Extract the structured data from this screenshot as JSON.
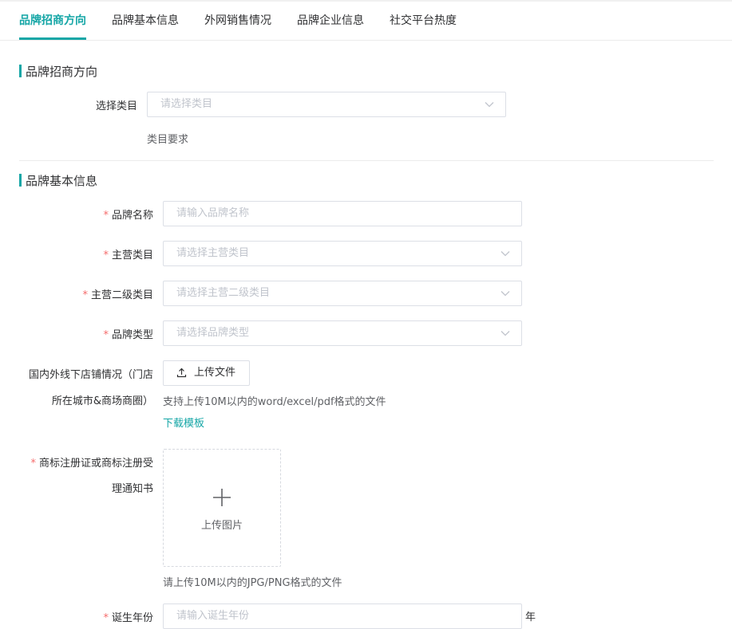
{
  "tabs": [
    {
      "label": "品牌招商方向",
      "active": true
    },
    {
      "label": "品牌基本信息",
      "active": false
    },
    {
      "label": "外网销售情况",
      "active": false
    },
    {
      "label": "品牌企业信息",
      "active": false
    },
    {
      "label": "社交平台热度",
      "active": false
    }
  ],
  "section1": {
    "title": "品牌招商方向",
    "category_label": "选择类目",
    "category_placeholder": "请选择类目",
    "category_requirement": "类目要求"
  },
  "section2": {
    "title": "品牌基本信息",
    "brand_name": {
      "label": "品牌名称",
      "placeholder": "请输入品牌名称",
      "required": true
    },
    "main_category": {
      "label": "主营类目",
      "placeholder": "请选择主营类目",
      "required": true
    },
    "sub_category": {
      "label": "主营二级类目",
      "placeholder": "请选择主营二级类目",
      "required": true
    },
    "brand_type": {
      "label": "品牌类型",
      "placeholder": "请选择品牌类型",
      "required": true
    },
    "offline_stores": {
      "label_line1": "国内外线下店铺情况（门店",
      "label_line2": "所在城市&商场商圈）",
      "upload_label": "上传文件",
      "hint": "支持上传10M以内的word/excel/pdf格式的文件",
      "template_link": "下载模板"
    },
    "trademark": {
      "label_line1": "商标注册证或商标注册受",
      "label_line2": "理通知书",
      "required": true,
      "upload_label": "上传图片",
      "hint": "请上传10M以内的JPG/PNG格式的文件"
    },
    "birth_year": {
      "label": "诞生年份",
      "placeholder": "请输入诞生年份",
      "suffix": "年",
      "required": true
    }
  },
  "required_mark": "*",
  "colors": {
    "accent": "#15a6a6",
    "required": "#f56c6c",
    "border": "#dcdfe6",
    "placeholder": "#c0c4cc"
  },
  "icons": [
    "chevron-down-icon",
    "upload-icon",
    "plus-icon"
  ]
}
